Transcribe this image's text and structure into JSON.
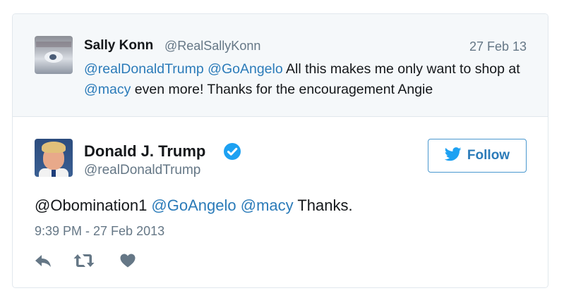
{
  "parent_tweet": {
    "author_name": "Sally Konn",
    "author_handle": "@RealSallyKonn",
    "date": "27 Feb 13",
    "text_parts": [
      {
        "text": "@realDonaldTrump",
        "type": "mention"
      },
      {
        "text": " ",
        "type": "text"
      },
      {
        "text": "@GoAngelo",
        "type": "mention"
      },
      {
        "text": " All this makes me only want to shop at ",
        "type": "text"
      },
      {
        "text": "@macy",
        "type": "mention"
      },
      {
        "text": " even more! Thanks for the encouragement Angie",
        "type": "text"
      }
    ]
  },
  "main_tweet": {
    "author_name": "Donald J. Trump",
    "author_handle": "@realDonaldTrump",
    "verified": true,
    "follow_label": "Follow",
    "text_parts": [
      {
        "text": "@Obomination1 ",
        "type": "text"
      },
      {
        "text": "@GoAngelo",
        "type": "mention"
      },
      {
        "text": " ",
        "type": "text"
      },
      {
        "text": "@macy",
        "type": "mention"
      },
      {
        "text": " Thanks.",
        "type": "text"
      }
    ],
    "timestamp": "9:39 PM - 27 Feb 2013"
  },
  "actions": {
    "reply_icon": "reply-icon",
    "retweet_icon": "retweet-icon",
    "like_icon": "heart-icon"
  },
  "colors": {
    "mention": "#2b7bb9",
    "muted": "#657786",
    "verified": "#1da1f2",
    "parent_bg": "#f5f8fa",
    "border": "#e1e8ed",
    "action_icon": "#657786"
  }
}
